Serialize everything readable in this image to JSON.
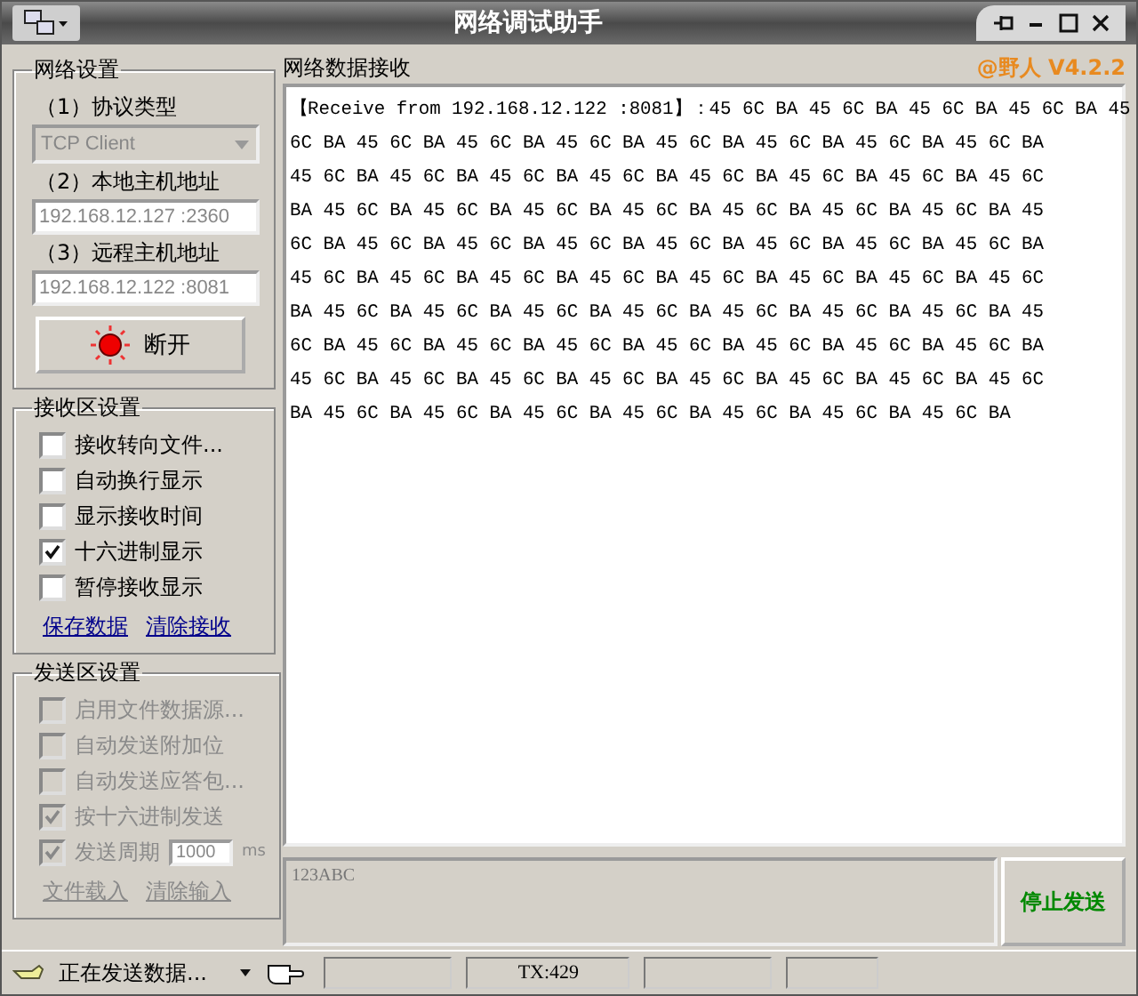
{
  "window": {
    "title": "网络调试助手",
    "version": "@野人 V4.2.2"
  },
  "network_settings": {
    "title": "网络设置",
    "protocol_label": "（1）协议类型",
    "protocol": {
      "value": "TCP Client",
      "disabled": true
    },
    "local_label": "（2）本地主机地址",
    "local_address": "192.168.12.127 :2360",
    "remote_label": "（3）远程主机地址",
    "remote_address": "192.168.12.122 :8081",
    "connect_button": {
      "label": "断开",
      "connected": true
    }
  },
  "receive_settings": {
    "title": "接收区设置",
    "options": [
      {
        "label": "接收转向文件...",
        "checked": false
      },
      {
        "label": "自动换行显示",
        "checked": false
      },
      {
        "label": "显示接收时间",
        "checked": false
      },
      {
        "label": "十六进制显示",
        "checked": true
      },
      {
        "label": "暂停接收显示",
        "checked": false
      }
    ],
    "links": [
      {
        "label": "保存数据",
        "disabled": false
      },
      {
        "label": "清除接收",
        "disabled": false
      }
    ]
  },
  "send_settings": {
    "title": "发送区设置",
    "options": [
      {
        "kind": "checkbox",
        "label": "启用文件数据源...",
        "checked": false,
        "disabled": true
      },
      {
        "kind": "checkbox",
        "label": "自动发送附加位",
        "checked": false,
        "disabled": true
      },
      {
        "kind": "checkbox",
        "label": "自动发送应答包...",
        "checked": false,
        "disabled": true
      },
      {
        "kind": "checkbox",
        "label": "按十六进制发送",
        "checked": true,
        "disabled": true
      },
      {
        "kind": "period",
        "label": "发送周期",
        "checked": true,
        "disabled": true,
        "value": "1000",
        "unit": "ms"
      }
    ],
    "links": [
      {
        "label": "文件载入",
        "disabled": true
      },
      {
        "label": "清除输入",
        "disabled": true
      }
    ]
  },
  "receive_panel": {
    "title": "网络数据接收",
    "lines": [
      "【Receive from 192.168.12.122 :8081】：45 6C BA 45 6C BA 45 6C BA 45 6C BA 45",
      "6C BA 45 6C BA 45 6C BA 45 6C BA 45 6C BA 45 6C BA 45 6C BA 45 6C BA",
      "45 6C BA 45 6C BA 45 6C BA 45 6C BA 45 6C BA 45 6C BA 45 6C BA 45 6C",
      "BA 45 6C BA 45 6C BA 45 6C BA 45 6C BA 45 6C BA 45 6C BA 45 6C BA 45",
      "6C BA 45 6C BA 45 6C BA 45 6C BA 45 6C BA 45 6C BA 45 6C BA 45 6C BA",
      "45 6C BA 45 6C BA 45 6C BA 45 6C BA 45 6C BA 45 6C BA 45 6C BA 45 6C",
      "BA 45 6C BA 45 6C BA 45 6C BA 45 6C BA 45 6C BA 45 6C BA 45 6C BA 45",
      "6C BA 45 6C BA 45 6C BA 45 6C BA 45 6C BA 45 6C BA 45 6C BA 45 6C BA",
      "45 6C BA 45 6C BA 45 6C BA 45 6C BA 45 6C BA 45 6C BA 45 6C BA 45 6C",
      "BA 45 6C BA 45 6C BA 45 6C BA 45 6C BA 45 6C BA 45 6C BA 45 6C BA"
    ]
  },
  "send_panel": {
    "input": "123ABC",
    "button": "停止发送"
  },
  "status_bar": {
    "message": "正在发送数据...",
    "tx": "TX:429"
  }
}
